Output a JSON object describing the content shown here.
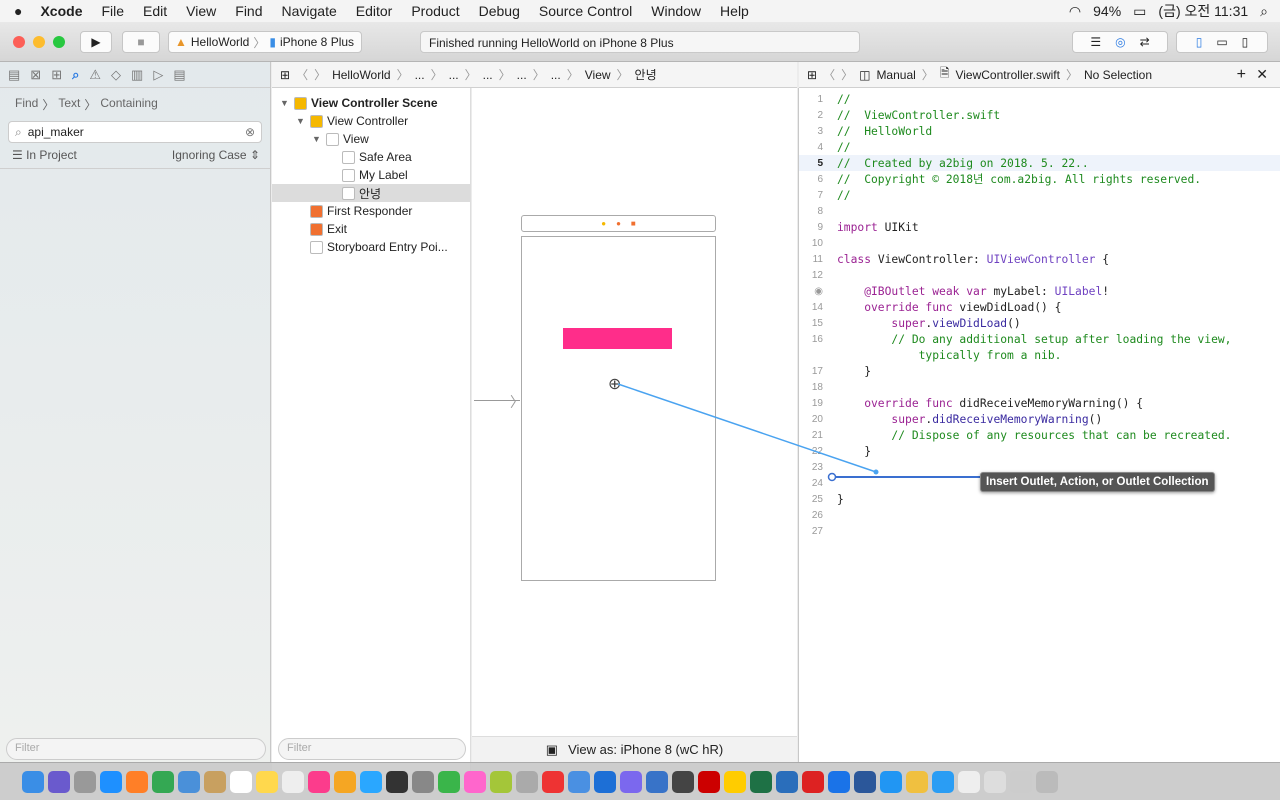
{
  "menubar": {
    "items": [
      "Xcode",
      "File",
      "Edit",
      "View",
      "Find",
      "Navigate",
      "Editor",
      "Product",
      "Debug",
      "Source Control",
      "Window",
      "Help"
    ],
    "battery": "94%",
    "clock": "(금) 오전 11:31"
  },
  "toolbar": {
    "scheme": "HelloWorld",
    "device": "iPhone 8 Plus",
    "activity": "Finished running HelloWorld on iPhone 8 Plus"
  },
  "navigator": {
    "breadcrumb": [
      "Find",
      "Text",
      "Containing"
    ],
    "search_value": "api_maker",
    "scope": "In Project",
    "case": "Ignoring Case",
    "filter_placeholder": "Filter"
  },
  "ib_jumpbar": {
    "items": [
      "HelloWorld",
      "...",
      "...",
      "...",
      "...",
      "...",
      "View",
      "안녕"
    ]
  },
  "outline": {
    "items": [
      {
        "label": "View Controller Scene",
        "level": 0,
        "bold": true,
        "tri": "▼"
      },
      {
        "label": "View Controller",
        "level": 1,
        "tri": "▼"
      },
      {
        "label": "View",
        "level": 2,
        "tri": "▼"
      },
      {
        "label": "Safe Area",
        "level": 3
      },
      {
        "label": "My Label",
        "level": 3
      },
      {
        "label": "안녕",
        "level": 3,
        "selected": true
      },
      {
        "label": "First Responder",
        "level": 1
      },
      {
        "label": "Exit",
        "level": 1
      },
      {
        "label": "Storyboard Entry Poi...",
        "level": 1
      }
    ],
    "filter_placeholder": "Filter"
  },
  "canvas": {
    "view_as": "View as: iPhone 8 (wC hR)",
    "label_color": "#ff2d8a"
  },
  "editor_jumpbar": {
    "mode": "Manual",
    "file": "ViewController.swift",
    "selection": "No Selection"
  },
  "code": [
    {
      "n": "1",
      "t": [
        [
          "//",
          "comment"
        ]
      ]
    },
    {
      "n": "2",
      "t": [
        [
          "//  ViewController.swift",
          "comment"
        ]
      ]
    },
    {
      "n": "3",
      "t": [
        [
          "//  HelloWorld",
          "comment"
        ]
      ]
    },
    {
      "n": "4",
      "t": [
        [
          "//",
          "comment"
        ]
      ]
    },
    {
      "n": "5",
      "hl": true,
      "t": [
        [
          "//  Created by a2big on 2018. 5. 22..",
          "comment"
        ]
      ]
    },
    {
      "n": "6",
      "t": [
        [
          "//  Copyright © 2018년 com.a2big. All rights reserved.",
          "comment"
        ]
      ]
    },
    {
      "n": "7",
      "t": [
        [
          "//",
          "comment"
        ]
      ]
    },
    {
      "n": "8",
      "t": []
    },
    {
      "n": "9",
      "t": [
        [
          "import",
          "kw"
        ],
        [
          " UIKit",
          "plain"
        ]
      ]
    },
    {
      "n": "10",
      "t": []
    },
    {
      "n": "11",
      "t": [
        [
          "class",
          "kw"
        ],
        [
          " ViewController: ",
          "plain"
        ],
        [
          "UIViewController",
          "type"
        ],
        [
          " {",
          "plain"
        ]
      ]
    },
    {
      "n": "12",
      "t": []
    },
    {
      "n": "◉",
      "t": [
        [
          "    @IBOutlet weak var",
          "kw"
        ],
        [
          " myLabel: ",
          "plain"
        ],
        [
          "UILabel",
          "type"
        ],
        [
          "!",
          "plain"
        ]
      ]
    },
    {
      "n": "14",
      "t": [
        [
          "    override func",
          "kw"
        ],
        [
          " viewDidLoad() {",
          "plain"
        ]
      ]
    },
    {
      "n": "15",
      "t": [
        [
          "        super",
          "kw"
        ],
        [
          ".",
          "plain"
        ],
        [
          "viewDidLoad",
          "fn"
        ],
        [
          "()",
          "plain"
        ]
      ]
    },
    {
      "n": "16",
      "t": [
        [
          "        // Do any additional setup after loading the view,",
          "comment"
        ]
      ]
    },
    {
      "n": "",
      "t": [
        [
          "            typically from a nib.",
          "comment"
        ]
      ]
    },
    {
      "n": "17",
      "t": [
        [
          "    }",
          "plain"
        ]
      ]
    },
    {
      "n": "18",
      "t": []
    },
    {
      "n": "19",
      "t": [
        [
          "    override func",
          "kw"
        ],
        [
          " didReceiveMemoryWarning() {",
          "plain"
        ]
      ]
    },
    {
      "n": "20",
      "t": [
        [
          "        super",
          "kw"
        ],
        [
          ".",
          "plain"
        ],
        [
          "didReceiveMemoryWarning",
          "fn"
        ],
        [
          "()",
          "plain"
        ]
      ]
    },
    {
      "n": "21",
      "t": [
        [
          "        // Dispose of any resources that can be recreated.",
          "comment"
        ]
      ]
    },
    {
      "n": "22",
      "t": [
        [
          "    }",
          "plain"
        ]
      ]
    },
    {
      "n": "23",
      "t": []
    },
    {
      "n": "24",
      "t": []
    },
    {
      "n": "25",
      "t": [
        [
          "}",
          "plain"
        ]
      ]
    },
    {
      "n": "26",
      "t": []
    },
    {
      "n": "27",
      "t": []
    }
  ],
  "tooltip": "Insert Outlet, Action, or Outlet Collection",
  "dock_colors": [
    "#3a8ee6",
    "#6a5acd",
    "#999",
    "#1e90ff",
    "#ff7f27",
    "#34a853",
    "#4a90d9",
    "#c8a060",
    "#fff",
    "#ffd84d",
    "#eee",
    "#fc3c8c",
    "#f5a623",
    "#2aa7ff",
    "#333",
    "#888",
    "#3ab54a",
    "#ff66cc",
    "#a4c639",
    "#aaa",
    "#e33",
    "#4a90e2",
    "#1d6fd6",
    "#7b68ee",
    "#3873c8",
    "#444",
    "#c00",
    "#ffcc00",
    "#1e7145",
    "#2a6ebb",
    "#d22",
    "#1a73e8",
    "#2b579a",
    "#2196f3",
    "#f0c040",
    "#2a9df4",
    "#eee",
    "#ddd",
    "#ccc",
    "#bbb"
  ]
}
